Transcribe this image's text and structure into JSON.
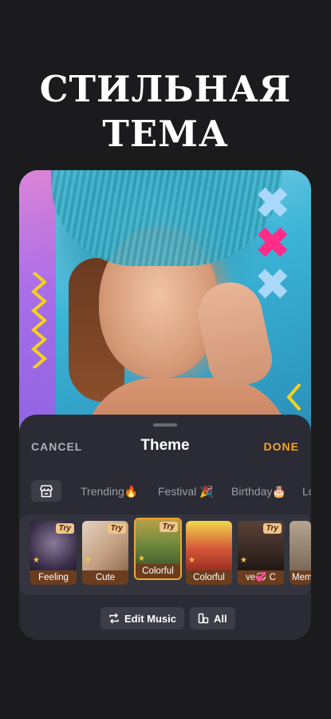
{
  "headline": {
    "line1": "СТИЛЬНАЯ",
    "line2": "ТЕМА"
  },
  "sheet": {
    "cancel_label": "CANCEL",
    "title": "Theme",
    "done_label": "DONE"
  },
  "categories": [
    {
      "label": "Trending🔥"
    },
    {
      "label": "Festival 🎉"
    },
    {
      "label": "Birthday🎂"
    },
    {
      "label": "Lo"
    }
  ],
  "themes": [
    {
      "label": "Feeling",
      "try": "Try",
      "tint": "#5a4a6a"
    },
    {
      "label": "Cute",
      "try": "Try",
      "tint": "#c9a98a"
    },
    {
      "label": "Colorful",
      "try": "Try",
      "tint": "#7a8a3a",
      "selected": true
    },
    {
      "label": "Colorful",
      "try": "",
      "tint": "#d9c34a"
    },
    {
      "label": "ve💞 C",
      "try": "Try",
      "tint": "#4a3a32"
    },
    {
      "label": "Mem",
      "try": "",
      "tint": "#8a7a6a"
    }
  ],
  "buttons": {
    "edit_music": "Edit Music",
    "all": "All"
  },
  "colors": {
    "accent": "#f4a52a",
    "sheet_bg": "#2a2b34",
    "page_bg": "#1b1b1d"
  }
}
